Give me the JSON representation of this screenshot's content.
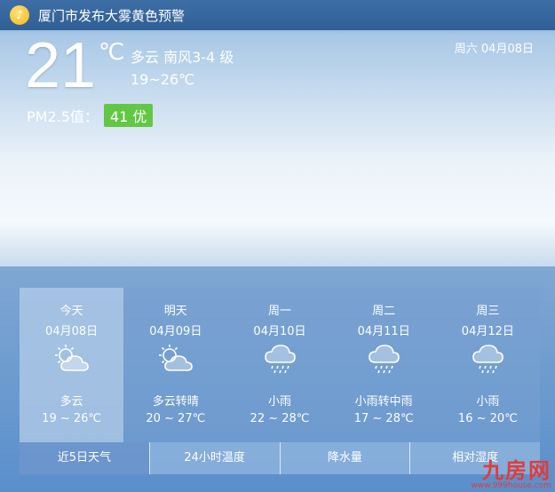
{
  "alert": {
    "text": "厦门市发布大雾黄色预警",
    "icon": "bell-icon"
  },
  "current": {
    "temperature": "21",
    "unit": "℃",
    "condition": "多云 南风3-4 级",
    "range": "19~26℃",
    "date": "周六 04月08日",
    "pm_label": "PM2.5值：",
    "pm_value": "41 优",
    "pm_color": "#62c745"
  },
  "forecast": [
    {
      "name": "今天",
      "date": "04月08日",
      "icon": "partly-cloudy-icon",
      "condition": "多云",
      "range": "19 ~ 26℃"
    },
    {
      "name": "明天",
      "date": "04月09日",
      "icon": "partly-cloudy-icon",
      "condition": "多云转晴",
      "range": "20 ~ 27℃"
    },
    {
      "name": "周一",
      "date": "04月10日",
      "icon": "rain-icon",
      "condition": "小雨",
      "range": "22 ~ 28℃"
    },
    {
      "name": "周二",
      "date": "04月11日",
      "icon": "rain-icon",
      "condition": "小雨转中雨",
      "range": "17 ~ 28℃"
    },
    {
      "name": "周三",
      "date": "04月12日",
      "icon": "rain-icon",
      "condition": "小雨",
      "range": "16 ~ 20℃"
    }
  ],
  "tabs": [
    "近5日天气",
    "24小时温度",
    "降水量",
    "相对湿度"
  ],
  "watermark": {
    "logo": "九房网",
    "url": "www.999house.com"
  }
}
